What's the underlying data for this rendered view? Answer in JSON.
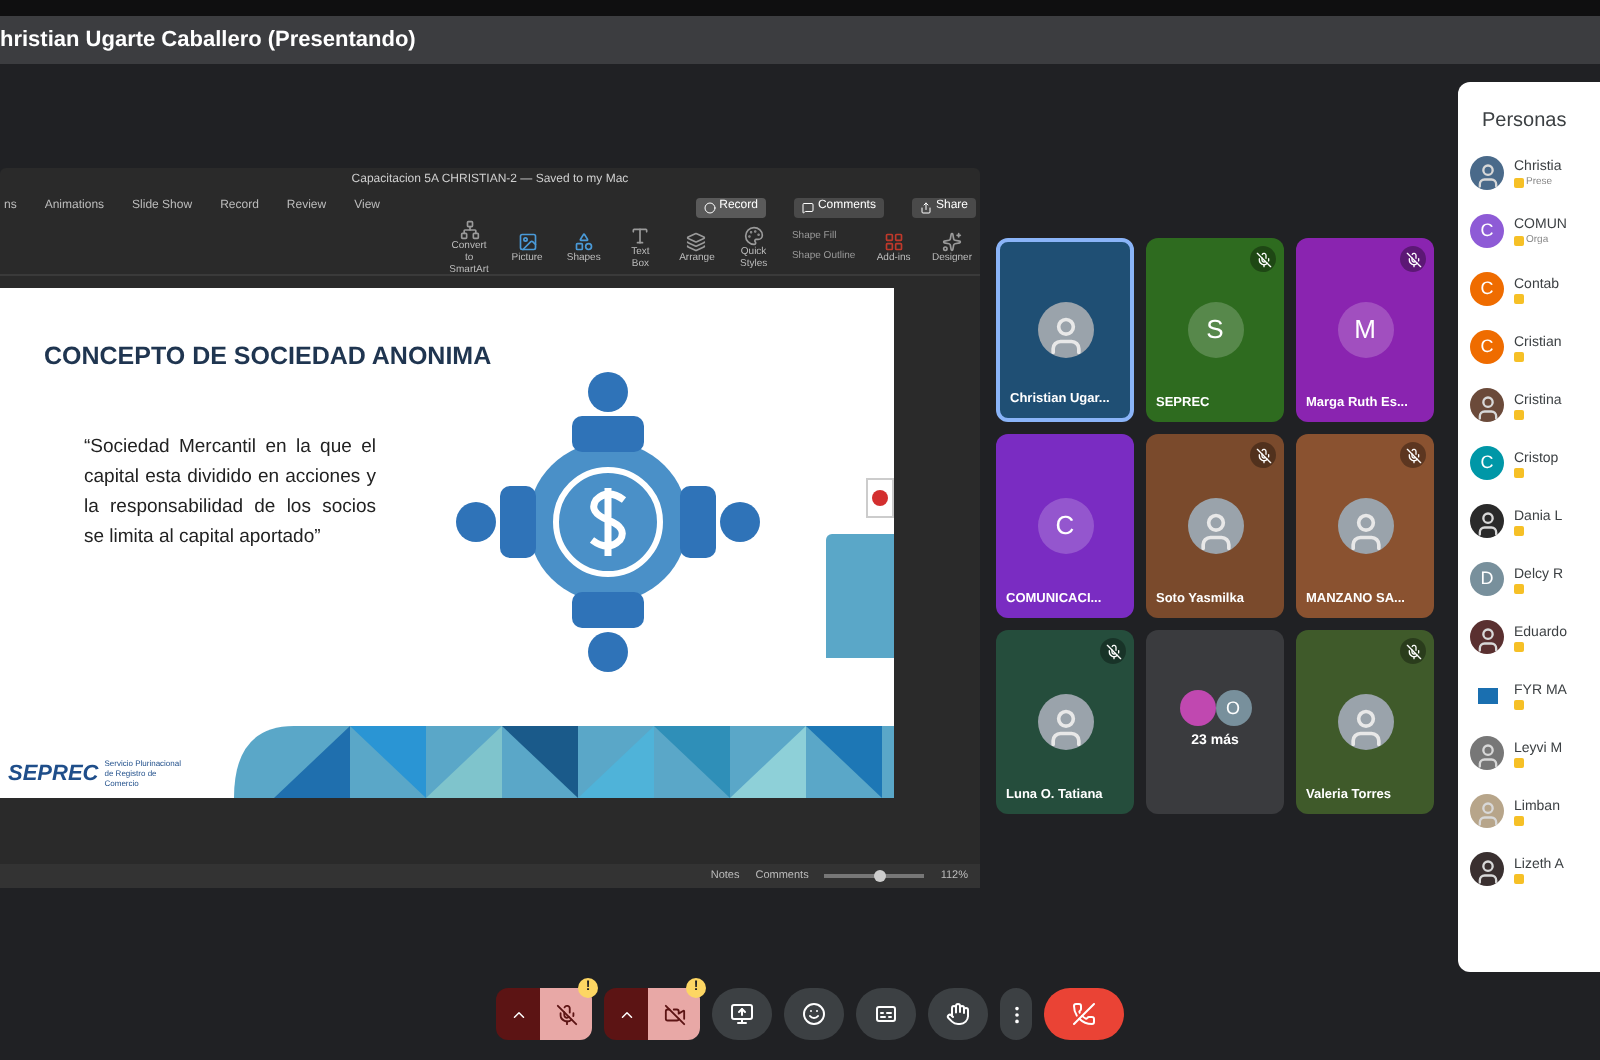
{
  "presenter_banner": {
    "title": "hristian Ugarte Caballero (Presentando)"
  },
  "powerpoint": {
    "document_title": "Capacitacion 5A CHRISTIAN-2 — Saved to my Mac",
    "ribbon_tabs": [
      {
        "label": "ns",
        "selected": false
      },
      {
        "label": "Animations",
        "selected": false
      },
      {
        "label": "Slide Show",
        "selected": false
      },
      {
        "label": "Record",
        "selected": false
      },
      {
        "label": "Review",
        "selected": false
      },
      {
        "label": "View",
        "selected": false
      }
    ],
    "actions": [
      {
        "kind": "record",
        "label": "Record"
      },
      {
        "kind": "comments",
        "label": "Comments"
      },
      {
        "kind": "share",
        "label": "Share"
      }
    ],
    "tools": [
      {
        "kind": "smartart",
        "label": "Convert to SmartArt"
      },
      {
        "kind": "picture",
        "label": "Picture"
      },
      {
        "kind": "shapes",
        "label": "Shapes"
      },
      {
        "kind": "textbox",
        "label": "Text Box"
      },
      {
        "kind": "arrange",
        "label": "Arrange"
      },
      {
        "kind": "styles",
        "label": "Quick Styles"
      },
      {
        "kind": "addins",
        "label": "Add-ins"
      },
      {
        "kind": "designer",
        "label": "Designer"
      }
    ],
    "shape_options": [
      "Shape Fill",
      "Shape Outline"
    ],
    "slide": {
      "title": "CONCEPTO DE SOCIEDAD ANONIMA",
      "quote": "“Sociedad Mercantil en la que el capital esta dividido en acciones y la responsabilidad de los socios se limita al capital aportado”",
      "logo_name": "SEPREC",
      "logo_caption": "Servicio Plurinacional de Registro de Comercio"
    },
    "status_bar": {
      "notes": "Notes",
      "comments": "Comments",
      "zoom": "112%",
      "level": 0.55
    }
  },
  "tiles": [
    {
      "kind": "photo",
      "name": "Christian Ugar...",
      "selected": true,
      "muted": false,
      "color": "#1f4f74"
    },
    {
      "kind": "letter",
      "name": "SEPREC",
      "letter": "S",
      "selected": false,
      "muted": true,
      "color": "#2e6b1f"
    },
    {
      "kind": "letter",
      "name": "Marga Ruth Es...",
      "letter": "M",
      "selected": false,
      "muted": true,
      "color": "#8a24b0"
    },
    {
      "kind": "letter",
      "name": "COMUNICACI...",
      "letter": "C",
      "selected": false,
      "muted": false,
      "color": "#7a2cc2"
    },
    {
      "kind": "photo",
      "name": "Soto Yasmilka",
      "selected": false,
      "muted": true,
      "color": "#7a4a2c"
    },
    {
      "kind": "photo",
      "name": "MANZANO SA...",
      "selected": false,
      "muted": true,
      "color": "#8a5230"
    },
    {
      "kind": "photo",
      "name": "Luna O. Tatiana",
      "selected": false,
      "muted": true,
      "color": "#254d3c"
    },
    {
      "kind": "more",
      "name": "23 más",
      "letter": "O",
      "selected": false,
      "muted": false,
      "color": "#3a3b3e"
    },
    {
      "kind": "photo",
      "name": "Valeria Torres",
      "selected": false,
      "muted": true,
      "color": "#3f5a2a"
    }
  ],
  "people_panel": {
    "title": "Personas",
    "people": [
      {
        "name": "Christia",
        "role": "Prese",
        "kind": "photo",
        "color": "#4a6a8a"
      },
      {
        "name": "COMUN",
        "role": "Orga",
        "kind": "letter",
        "letter": "C",
        "color": "#8e5bd6"
      },
      {
        "name": "Contab",
        "kind": "letter",
        "letter": "C",
        "color": "#ef6c00"
      },
      {
        "name": "Cristian",
        "kind": "letter",
        "letter": "C",
        "color": "#ef6c00"
      },
      {
        "name": "Cristina",
        "kind": "photo",
        "color": "#6b4a3a"
      },
      {
        "name": "Cristop",
        "kind": "letter",
        "letter": "C",
        "color": "#0097a7"
      },
      {
        "name": "Dania L",
        "kind": "photo",
        "color": "#2a2a2a"
      },
      {
        "name": "Delcy R",
        "kind": "letter",
        "letter": "D",
        "color": "#78909c"
      },
      {
        "name": "Eduardo",
        "kind": "photo",
        "color": "#5a3030"
      },
      {
        "name": "FYR MA",
        "kind": "logo",
        "color": "#1a6fb0"
      },
      {
        "name": "Leyvi M",
        "kind": "photo",
        "color": "#777777"
      },
      {
        "name": "Limban",
        "kind": "photo",
        "color": "#b7a58a"
      },
      {
        "name": "Lizeth A",
        "kind": "photo",
        "color": "#3a3030"
      }
    ]
  },
  "controls": [
    {
      "kind": "mic",
      "muted": true,
      "warning": "!"
    },
    {
      "kind": "camera",
      "muted": true,
      "warning": "!"
    },
    {
      "kind": "present"
    },
    {
      "kind": "emoji"
    },
    {
      "kind": "captions"
    },
    {
      "kind": "hand"
    },
    {
      "kind": "more"
    },
    {
      "kind": "hangup"
    }
  ]
}
